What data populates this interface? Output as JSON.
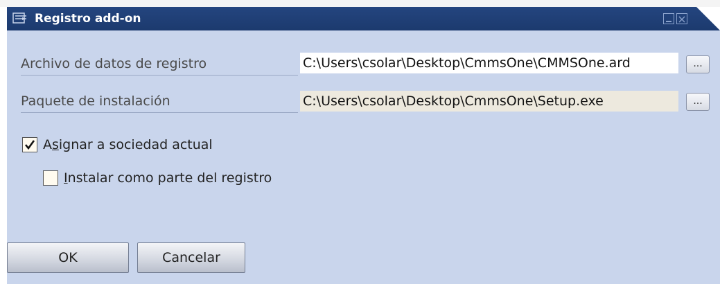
{
  "window": {
    "title": "Registro add-on",
    "title_icon": "form-icon",
    "minimize_icon": "minimize-icon",
    "close_icon": "close-icon"
  },
  "fields": [
    {
      "label": "Archivo de datos de registro",
      "value": "C:\\Users\\csolar\\Desktop\\CmmsOne\\CMMSOne.ard",
      "browse_label": "..."
    },
    {
      "label": "Paquete de instalación",
      "value": "C:\\Users\\csolar\\Desktop\\CmmsOne\\Setup.exe",
      "browse_label": "..."
    }
  ],
  "options": {
    "assign_company": {
      "label_pre": "A",
      "label_mnemonic": "s",
      "label_post": "ignar a sociedad actual",
      "checked": true
    },
    "install_as_part": {
      "label_pre": "",
      "label_mnemonic": "I",
      "label_post": "nstalar como parte del registro",
      "checked": false
    }
  },
  "buttons": {
    "ok": "OK",
    "cancel": "Cancelar"
  },
  "colors": {
    "titlebar": "#1c3a6e",
    "dialog_background": "#c9d5ec",
    "readonly_field": "#ede9de"
  }
}
